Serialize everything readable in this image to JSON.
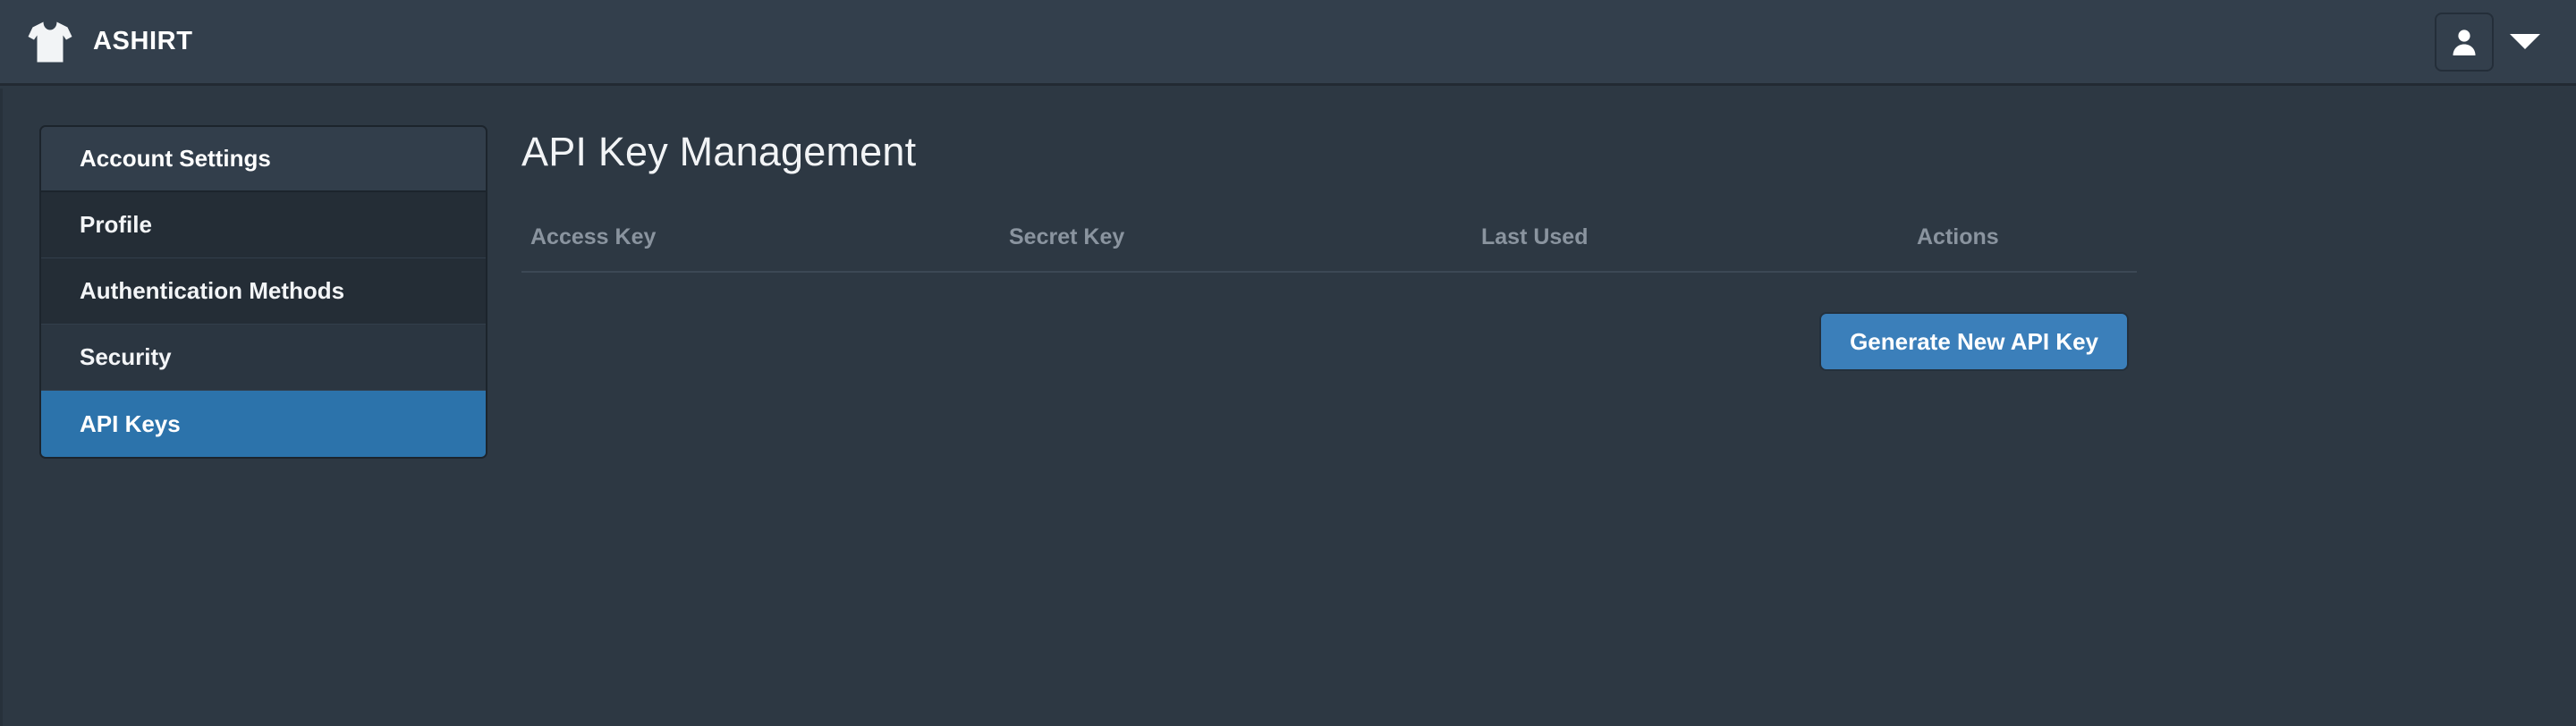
{
  "colors": {
    "page_background": "#2d3843",
    "topbar_background": "#333f4c",
    "sidebar_active": "#2c73ab",
    "button_primary": "#3b7fba",
    "table_header_text": "#8a949f"
  },
  "topbar": {
    "brand_name": "ASHIRT",
    "logo_icon": "tshirt-icon",
    "user_menu": {
      "avatar_icon": "person-icon",
      "caret_icon": "chevron-down-icon"
    }
  },
  "sidebar": {
    "header": "Account Settings",
    "items": [
      {
        "label": "Profile",
        "active": false
      },
      {
        "label": "Authentication Methods",
        "active": false
      },
      {
        "label": "Security",
        "active": false
      },
      {
        "label": "API Keys",
        "active": true
      }
    ]
  },
  "main": {
    "title": "API Key Management",
    "table": {
      "columns": [
        "Access Key",
        "Secret Key",
        "Last Used",
        "Actions"
      ],
      "rows": []
    },
    "generate_button_label": "Generate New API Key"
  }
}
